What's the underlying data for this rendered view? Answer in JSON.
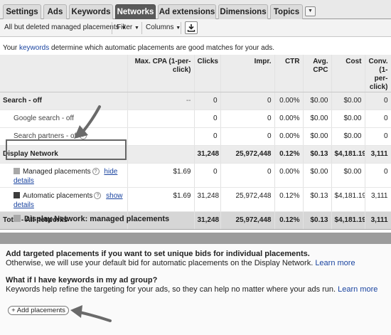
{
  "tabs": [
    {
      "label": "Settings"
    },
    {
      "label": "Ads"
    },
    {
      "label": "Keywords"
    },
    {
      "label": "Networks"
    },
    {
      "label": "Ad extensions"
    },
    {
      "label": "Dimensions"
    },
    {
      "label": "Topics"
    }
  ],
  "tab_more_icon": "▼",
  "toolbar": {
    "view_filter": "All but deleted managed placements",
    "filter_label": "Filter",
    "columns_label": "Columns",
    "download_icon": "download-icon"
  },
  "info_text": {
    "prefix": "Your ",
    "link": "keywords",
    "suffix": " determine which automatic placements are good matches for your ads."
  },
  "table": {
    "headers": [
      "",
      "Max. CPA (1-per-click)",
      "Clicks",
      "Impr.",
      "CTR",
      "Avg. CPC",
      "Cost",
      "Conv. (1-per-click)"
    ],
    "rows": {
      "search_off": {
        "label": "Search - off",
        "values": [
          "--",
          "0",
          "0",
          "0.00%",
          "$0.00",
          "$0.00",
          "0"
        ]
      },
      "google_search": {
        "label": "Google search - off",
        "values": [
          "",
          "0",
          "0",
          "0.00%",
          "$0.00",
          "$0.00",
          "0"
        ]
      },
      "search_partners": {
        "label": "Search partners - off",
        "values": [
          "",
          "0",
          "0",
          "0.00%",
          "$0.00",
          "$0.00",
          "0"
        ]
      },
      "display_network": {
        "label": "Display Network",
        "values": [
          "",
          "31,248",
          "25,972,448",
          "0.12%",
          "$0.13",
          "$4,181.19",
          "3,111"
        ]
      },
      "managed": {
        "label": "Managed placements",
        "link_hide": "hide",
        "link_details": "details",
        "values": [
          "$1.69",
          "0",
          "0",
          "0.00%",
          "$0.00",
          "$0.00",
          "0"
        ]
      },
      "automatic": {
        "label": "Automatic placements",
        "link_show": "show",
        "link_details": "details",
        "values": [
          "$1.69",
          "31,248",
          "25,972,448",
          "0.12%",
          "$0.13",
          "$4,181.19",
          "3,111"
        ]
      },
      "total": {
        "label": "Total - All networks",
        "values": [
          "",
          "31,248",
          "25,972,448",
          "0.12%",
          "$0.13",
          "$4,181.19",
          "3,111"
        ]
      }
    }
  },
  "colors": {
    "managed_swatch": "#a8a8a8",
    "automatic_swatch": "#3c3c3c",
    "active_tab": "#5a5a5a"
  },
  "panel": {
    "legend": "Display Network: managed placements",
    "heading1": "Add targeted placements if you want to set unique bids for individual placements.",
    "text1": "Otherwise, we will use your default bid for automatic placements on the Display Network.",
    "learn_more_1": "Learn more",
    "heading2": "What if I have keywords in my ad group?",
    "text2": "Keywords help refine the targeting for your ads, so they can help no matter where your ads run.",
    "learn_more_2": "Learn more",
    "add_button": "+ Add placements"
  }
}
